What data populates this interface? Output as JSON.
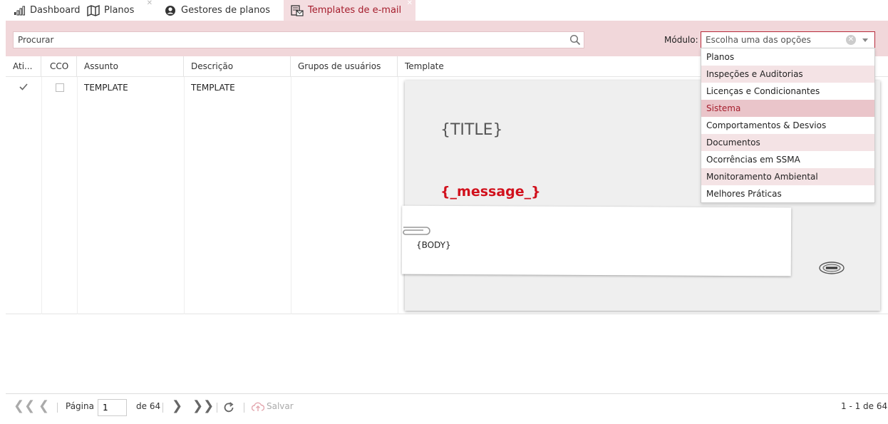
{
  "tabs": [
    {
      "label": "Dashboard",
      "icon": "bar-chart-icon"
    },
    {
      "label": "Planos",
      "icon": "map-icon"
    },
    {
      "label": "Gestores de planos",
      "icon": "user-circle-icon"
    },
    {
      "label": "Templates de e-mail",
      "icon": "email-template-icon"
    }
  ],
  "toolbar": {
    "search_placeholder": "Procurar",
    "module_label": "Módulo:",
    "module_placeholder": "Escolha uma das opções"
  },
  "dropdown": {
    "options": [
      "Planos",
      "Inspeções e Auditorias",
      "Licenças e Condicionantes",
      "Sistema",
      "Comportamentos & Desvios",
      "Documentos",
      "Ocorrências em SSMA",
      "Monitoramento Ambiental",
      "Melhores Práticas"
    ],
    "highlighted": "Sistema"
  },
  "table": {
    "headers": [
      "Ati...",
      "CCO",
      "Assunto",
      "Descrição",
      "Grupos de usuários",
      "Template"
    ],
    "rows": [
      {
        "active": true,
        "cco": false,
        "subject": "TEMPLATE",
        "description": "TEMPLATE",
        "template": {
          "title": "{TITLE}",
          "message": "{_message_}",
          "body": "{BODY}"
        }
      }
    ]
  },
  "pager": {
    "page_label": "Página",
    "page_value": "1",
    "of_label": "de 64",
    "save_label": "Salvar",
    "count_label": "1 - 1 de 64"
  },
  "colors": {
    "accent": "#a51d2c",
    "toolbar_bg": "#f1d7da",
    "message_red": "#d1101c"
  }
}
